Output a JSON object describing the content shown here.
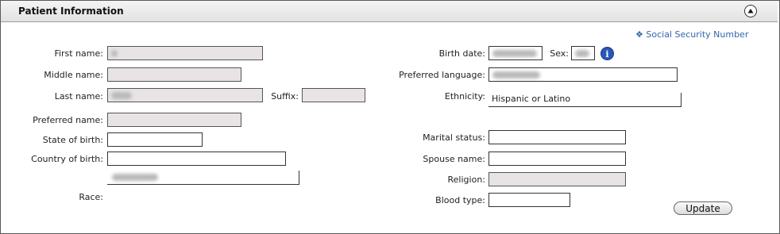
{
  "panel": {
    "title": "Patient Information",
    "collapse_icon": "chevron-up-icon"
  },
  "ssn_link": {
    "icon": "diamond-icon",
    "label": "Social Security Number"
  },
  "left": {
    "first_name_label": "First name:",
    "middle_name_label": "Middle name:",
    "last_name_label": "Last name:",
    "suffix_label": "Suffix:",
    "preferred_name_label": "Preferred name:",
    "state_of_birth_label": "State of birth:",
    "country_of_birth_label": "Country of birth:",
    "race_label": "Race:"
  },
  "right": {
    "birth_date_label": "Birth date:",
    "sex_label": "Sex:",
    "preferred_language_label": "Preferred language:",
    "ethnicity_label": "Ethnicity:",
    "ethnicity_value": "Hispanic or Latino",
    "marital_status_label": "Marital status:",
    "spouse_name_label": "Spouse name:",
    "religion_label": "Religion:",
    "blood_type_label": "Blood type:"
  },
  "info_icon": {
    "glyph": "i",
    "name": "info-icon"
  },
  "actions": {
    "update_label": "Update"
  }
}
